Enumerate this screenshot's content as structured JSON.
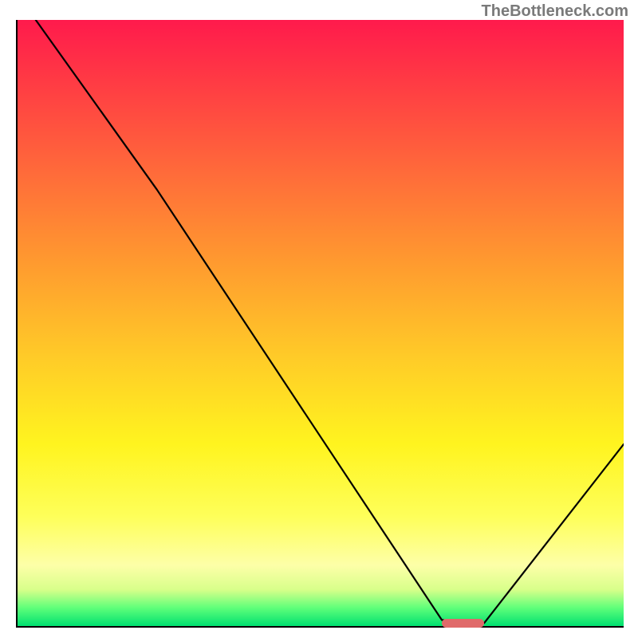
{
  "watermark": "TheBottleneck.com",
  "chart_data": {
    "type": "line",
    "title": "",
    "xlabel": "",
    "ylabel": "",
    "xlim": [
      0,
      100
    ],
    "ylim": [
      0,
      100
    ],
    "x": [
      3,
      23,
      70,
      77,
      100
    ],
    "values": [
      100,
      72,
      1,
      0.5,
      30
    ],
    "marker": {
      "x_start": 70,
      "x_end": 77,
      "y": 0.5
    },
    "grid": false,
    "legend": false,
    "gradient_background": true,
    "gradient_stops": [
      {
        "pos": 0,
        "color": "#ff1a4c"
      },
      {
        "pos": 10,
        "color": "#ff3a44"
      },
      {
        "pos": 25,
        "color": "#ff6a3a"
      },
      {
        "pos": 40,
        "color": "#ff9a2f"
      },
      {
        "pos": 55,
        "color": "#ffc928"
      },
      {
        "pos": 70,
        "color": "#fff41f"
      },
      {
        "pos": 82,
        "color": "#feff5a"
      },
      {
        "pos": 90,
        "color": "#fdffa8"
      },
      {
        "pos": 94,
        "color": "#d8ff8a"
      },
      {
        "pos": 97,
        "color": "#5fff7a"
      },
      {
        "pos": 100,
        "color": "#00e070"
      }
    ]
  }
}
